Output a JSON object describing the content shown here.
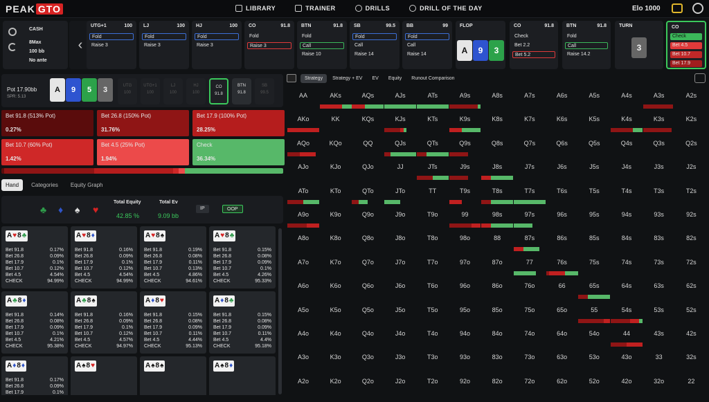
{
  "nav": {
    "logo_a": "PEAK",
    "logo_b": "GTO",
    "links": [
      "LIBRARY",
      "TRAINER",
      "DRILLS",
      "DRILL OF THE DAY"
    ],
    "elo": "Elo 1000"
  },
  "info": {
    "type": "CASH",
    "table": "8Max",
    "stack": "100 bb",
    "ante": "No ante"
  },
  "actions_path": [
    {
      "pos": "UTG+1",
      "stack": "100",
      "opts": [
        "Fold",
        "Raise 3"
      ],
      "sel": 0
    },
    {
      "pos": "LJ",
      "stack": "100",
      "opts": [
        "Fold",
        "Raise 3"
      ],
      "sel": 0
    },
    {
      "pos": "HJ",
      "stack": "100",
      "opts": [
        "Fold",
        "Raise 3"
      ],
      "sel": 0
    },
    {
      "pos": "CO",
      "stack": "91.8",
      "opts": [
        "Fold",
        "Raise 3"
      ],
      "sel": 1
    },
    {
      "pos": "BTN",
      "stack": "91.8",
      "opts": [
        "Fold",
        "Call",
        "Raise 10"
      ],
      "sel": 1
    },
    {
      "pos": "SB",
      "stack": "99.5",
      "opts": [
        "Fold",
        "Call",
        "Raise 14"
      ],
      "sel": 0
    },
    {
      "pos": "BB",
      "stack": "99",
      "opts": [
        "Fold",
        "Call",
        "Raise 14"
      ],
      "sel": 0
    }
  ],
  "flop": {
    "label": "FLOP",
    "cards": [
      "A",
      "9",
      "3"
    ]
  },
  "co2": {
    "pos": "CO",
    "stack": "91.8",
    "opts": [
      "Check",
      "Bet 2.2",
      "Bet 5.2"
    ],
    "sel": 2
  },
  "btn2": {
    "pos": "BTN",
    "stack": "91.8",
    "opts": [
      "Fold",
      "Call",
      "Raise 14.2"
    ],
    "sel": 1
  },
  "turn": {
    "label": "TURN",
    "stack": "91.8",
    "card": "3"
  },
  "co3": {
    "pos": "CO",
    "stack": "91.8",
    "opts": [
      "Check",
      "Bet 4.5",
      "Bet 10.7",
      "Bet 17.9"
    ]
  },
  "pot": {
    "label": "Pot",
    "value": "17.90bb",
    "spr": "SPR: 5.13",
    "board": [
      "A",
      "9",
      "5",
      "3"
    ]
  },
  "seats": [
    {
      "n": "UTG",
      "s": "100"
    },
    {
      "n": "UTG+1",
      "s": "100"
    },
    {
      "n": "LJ",
      "s": "100"
    },
    {
      "n": "HJ",
      "s": "100"
    },
    {
      "n": "CO",
      "s": "91.8"
    },
    {
      "n": "BTN",
      "s": "91.8"
    },
    {
      "n": "SB",
      "s": "99.5"
    }
  ],
  "bet_actions": [
    {
      "label": "Bet 91.8 (513% Pot)",
      "pct": "0.27%",
      "color": "#5a0c0c"
    },
    {
      "label": "Bet 26.8 (150% Pot)",
      "pct": "31.76%",
      "color": "#8f1515"
    },
    {
      "label": "Bet 17.9 (100% Pot)",
      "pct": "28.25%",
      "color": "#b51d1d"
    },
    {
      "label": "Bet 10.7 (60% Pot)",
      "pct": "1.42%",
      "color": "#cf2828"
    },
    {
      "label": "Bet 4.5 (25% Pot)",
      "pct": "1.94%",
      "color": "#ec4a4a"
    },
    {
      "label": "Check",
      "pct": "36.34%",
      "color": "#57b869"
    }
  ],
  "tabs": [
    "Hand",
    "Categories",
    "Equity Graph"
  ],
  "equity": {
    "total_equity_label": "Total Equity",
    "total_equity": "42.85 %",
    "total_ev_label": "Total Ev",
    "total_ev": "9.09 bb",
    "ip": "IP",
    "oop": "OOP"
  },
  "hands": [
    {
      "c1": "A",
      "s1": "♥",
      "c2": "8",
      "s2": "♣",
      "rows": [
        [
          "Bet 91.8",
          "0.17%"
        ],
        [
          "Bet 26.8",
          "0.09%"
        ],
        [
          "Bet 17.9",
          "0.1%"
        ],
        [
          "Bet 10.7",
          "0.12%"
        ],
        [
          "Bet 4.5",
          "4.54%"
        ],
        [
          "CHECK",
          "94.99%"
        ]
      ]
    },
    {
      "c1": "A",
      "s1": "♥",
      "c2": "8",
      "s2": "♦",
      "rows": [
        [
          "Bet 91.8",
          "0.16%"
        ],
        [
          "Bet 26.8",
          "0.09%"
        ],
        [
          "Bet 17.9",
          "0.1%"
        ],
        [
          "Bet 10.7",
          "0.12%"
        ],
        [
          "Bet 4.5",
          "4.54%"
        ],
        [
          "CHECK",
          "94.99%"
        ]
      ]
    },
    {
      "c1": "A",
      "s1": "♥",
      "c2": "8",
      "s2": "♠",
      "rows": [
        [
          "Bet 91.8",
          "0.19%"
        ],
        [
          "Bet 26.8",
          "0.08%"
        ],
        [
          "Bet 17.9",
          "0.11%"
        ],
        [
          "Bet 10.7",
          "0.13%"
        ],
        [
          "Bet 4.5",
          "4.86%"
        ],
        [
          "CHECK",
          "94.61%"
        ]
      ]
    },
    {
      "c1": "A",
      "s1": "♥",
      "c2": "8",
      "s2": "♣",
      "rows": [
        [
          "Bet 91.8",
          "0.15%"
        ],
        [
          "Bet 26.8",
          "0.08%"
        ],
        [
          "Bet 17.9",
          "0.09%"
        ],
        [
          "Bet 10.7",
          "0.1%"
        ],
        [
          "Bet 4.5",
          "4.26%"
        ],
        [
          "CHECK",
          "95.33%"
        ]
      ]
    },
    {
      "c1": "A",
      "s1": "♣",
      "c2": "8",
      "s2": "♦",
      "rows": [
        [
          "Bet 91.8",
          "0.14%"
        ],
        [
          "Bet 26.8",
          "0.08%"
        ],
        [
          "Bet 17.9",
          "0.09%"
        ],
        [
          "Bet 10.7",
          "0.1%"
        ],
        [
          "Bet 4.5",
          "4.21%"
        ],
        [
          "CHECK",
          "95.38%"
        ]
      ]
    },
    {
      "c1": "A",
      "s1": "♣",
      "c2": "8",
      "s2": "♠",
      "rows": [
        [
          "Bet 91.8",
          "0.16%"
        ],
        [
          "Bet 26.8",
          "0.09%"
        ],
        [
          "Bet 17.9",
          "0.1%"
        ],
        [
          "Bet 10.7",
          "0.12%"
        ],
        [
          "Bet 4.5",
          "4.57%"
        ],
        [
          "CHECK",
          "94.97%"
        ]
      ]
    },
    {
      "c1": "A",
      "s1": "♦",
      "c2": "8",
      "s2": "♥",
      "rows": [
        [
          "Bet 91.8",
          "0.15%"
        ],
        [
          "Bet 26.8",
          "0.08%"
        ],
        [
          "Bet 17.9",
          "0.09%"
        ],
        [
          "Bet 10.7",
          "0.11%"
        ],
        [
          "Bet 4.5",
          "4.44%"
        ],
        [
          "CHECK",
          "95.13%"
        ]
      ]
    },
    {
      "c1": "A",
      "s1": "♦",
      "c2": "8",
      "s2": "♣",
      "rows": [
        [
          "Bet 91.8",
          "0.15%"
        ],
        [
          "Bet 26.8",
          "0.08%"
        ],
        [
          "Bet 17.9",
          "0.09%"
        ],
        [
          "Bet 10.7",
          "0.11%"
        ],
        [
          "Bet 4.5",
          "4.4%"
        ],
        [
          "CHECK",
          "95.18%"
        ]
      ]
    },
    {
      "c1": "A",
      "s1": "♦",
      "c2": "8",
      "s2": "♦",
      "rows": [
        [
          "Bet 91.8",
          "0.17%"
        ],
        [
          "Bet 26.8",
          "0.09%"
        ],
        [
          "Bet 17.9",
          "0.1%"
        ]
      ]
    },
    {
      "c1": "A",
      "s1": "♠",
      "c2": "8",
      "s2": "♥",
      "rows": []
    },
    {
      "c1": "A",
      "s1": "♠",
      "c2": "8",
      "s2": "♠",
      "rows": []
    },
    {
      "c1": "A",
      "s1": "♠",
      "c2": "8",
      "s2": "♦",
      "rows": []
    }
  ],
  "right_tabs": [
    "Strategy",
    "Strategy + EV",
    "EV",
    "Equity",
    "Runout Comparison"
  ],
  "ranks": [
    "A",
    "K",
    "Q",
    "J",
    "T",
    "9",
    "8",
    "7",
    "6",
    "5",
    "4",
    "3",
    "2"
  ],
  "mix": {
    "AKs": [
      0.0,
      0.7,
      0.3
    ],
    "AQs": [
      0.0,
      0.4,
      0.6
    ],
    "AJs": [
      0,
      0,
      1
    ],
    "ATs": [
      0,
      0,
      1
    ],
    "A9s": [
      0.9,
      0,
      0.1
    ],
    "A3s": [
      0.95,
      0,
      0
    ],
    "AKo": [
      0,
      1,
      0
    ],
    "KJs": [
      0.5,
      0.1,
      0.1
    ],
    "K9s": [
      0,
      0.4,
      0.6
    ],
    "K4s": [
      0.7,
      0,
      0.3
    ],
    "K3s": [
      0.9,
      0,
      0
    ],
    "AQo": [
      0.4,
      0.5,
      0
    ],
    "Q9s": [
      0.6,
      0,
      0
    ],
    "J9s": [
      0.6,
      0,
      0
    ],
    "QJs": [
      0.2,
      0,
      0.8
    ],
    "QTs": [
      0.3,
      0,
      0.7
    ],
    "JTs": [
      0.5,
      0,
      0.5
    ],
    "J8s": [
      0,
      0.3,
      0.7
    ],
    "J7s": [
      0,
      0,
      0
    ],
    "ATo": [
      0.5,
      0,
      0.5
    ],
    "QTo": [
      0.2,
      0,
      0.3
    ],
    "JTo": [
      0,
      0,
      0.5
    ],
    "T8s": [
      0.3,
      0,
      0.7
    ],
    "T7s": [
      0,
      0,
      1
    ],
    "T9s": [
      0,
      0.4,
      0
    ],
    "A9o": [
      0.6,
      0.4,
      0
    ],
    "99": [
      0.7,
      0.3,
      0
    ],
    "98s": [
      0,
      0.3,
      0.7
    ],
    "97s": [
      0,
      0,
      0.6
    ],
    "87s": [
      0,
      0.3,
      0.5
    ],
    "76s": [
      0.1,
      0.5,
      0.4
    ],
    "77": [
      0,
      0,
      0.7
    ],
    "55": [
      0.8,
      0.2,
      0
    ],
    "65s": [
      0.3,
      0,
      0.7
    ],
    "54s": [
      0.6,
      0.3,
      0.1
    ],
    "44": [
      0.5,
      0.5,
      0
    ]
  }
}
